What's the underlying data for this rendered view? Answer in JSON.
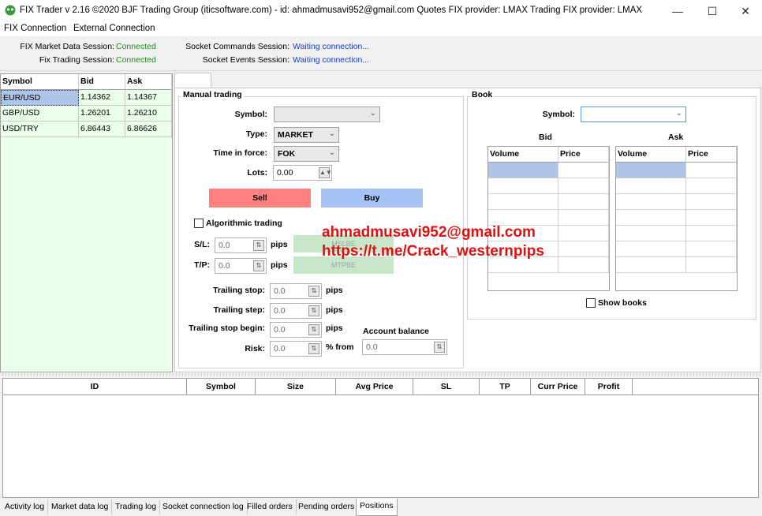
{
  "window": {
    "title": "FIX Trader v 2.16 ©2020 BJF Trading Group (iticsoftware.com) - id: ahmadmusavi952@gmail.com Quotes FIX provider: LMAX Trading FIX provider: LMAX",
    "minimize": "—",
    "maximize": "☐",
    "close": "✕"
  },
  "menu": [
    "FIX Connection",
    "External Connection"
  ],
  "status": {
    "market_data_label": "FIX Market Data Session:",
    "market_data_value": "Connected",
    "trading_label": "Fix Trading Session:",
    "trading_value": "Connected",
    "socket_commands_label": "Socket Commands Session:",
    "socket_commands_value": "Waiting connection...",
    "socket_events_label": "Socket Events Session:",
    "socket_events_value": "Waiting connection..."
  },
  "symbols": {
    "headers": [
      "Symbol",
      "Bid",
      "Ask"
    ],
    "rows": [
      [
        "EUR/USD",
        "1.14362",
        "1.14367"
      ],
      [
        "GBP/USD",
        "1.26201",
        "1.26210"
      ],
      [
        "USD/TRY",
        "6.86443",
        "6.86626"
      ]
    ]
  },
  "manual": {
    "group_label": "Manual trading",
    "symbol_label": "Symbol:",
    "symbol_value": "",
    "type_label": "Type:",
    "type_value": "MARKET",
    "tif_label": "Time in force:",
    "tif_value": "FOK",
    "lots_label": "Lots:",
    "lots_value": "0.00",
    "sell": "Sell",
    "buy": "Buy",
    "algo_label": "Algorithmic trading",
    "sl_label": "S/L:",
    "sl_value": "0.0",
    "tp_label": "T/P:",
    "tp_value": "0.0",
    "pips": "pips",
    "mslbe": "MSLBE",
    "mtpbe": "MTPBE",
    "trailing_stop_label": "Trailing stop:",
    "trailing_stop_value": "0.0",
    "trailing_step_label": "Trailing step:",
    "trailing_step_value": "0.0",
    "trailing_begin_label": "Trailing stop begin:",
    "trailing_begin_value": "0.0",
    "risk_label": "Risk:",
    "risk_value": "0.0",
    "percent_from": "% from",
    "account_balance_label": "Account balance",
    "account_balance_value": "0.0"
  },
  "book": {
    "group_label": "Book",
    "symbol_label": "Symbol:",
    "bid_label": "Bid",
    "ask_label": "Ask",
    "volume": "Volume",
    "price": "Price",
    "show_books": "Show books"
  },
  "watermark": {
    "line1": "ahmadmusavi952@gmail.com",
    "line2": "https://t.me/Crack_westernpips"
  },
  "positions": {
    "headers": [
      "ID",
      "Symbol",
      "Size",
      "Avg Price",
      "SL",
      "TP",
      "Curr Price",
      "Profit"
    ]
  },
  "bottom_tabs": [
    "Activity log",
    "Market data log",
    "Trading log",
    "Socket connection log",
    "Filled orders",
    "Pending orders",
    "Positions"
  ],
  "colors": {
    "connected": "#1b8f1b",
    "waiting": "#1a3fc0",
    "sell": "#ff8080",
    "buy": "#a4c2f4",
    "symbol_bg": "#eaffea",
    "watermark": "#e01010"
  }
}
